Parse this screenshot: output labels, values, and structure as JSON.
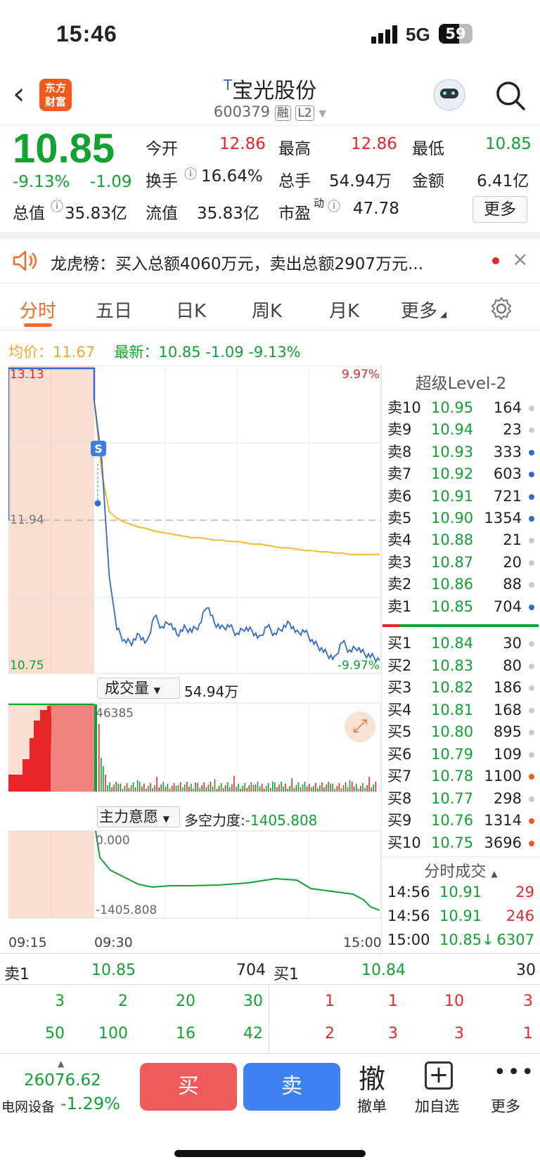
{
  "status": {
    "time": "15:46",
    "network": "5G",
    "battery": "59"
  },
  "header": {
    "logo_line1": "东方",
    "logo_line2": "财富",
    "title_prefix": "T",
    "title": "宝光股份",
    "code": "600379",
    "tag1": "融",
    "tag2": "L2"
  },
  "quote": {
    "price": "10.85",
    "pct": "-9.13%",
    "chg": "-1.09",
    "open_label": "今开",
    "open": "12.86",
    "high_label": "最高",
    "high": "12.86",
    "low_label": "最低",
    "low": "10.85",
    "turnover_label": "换手",
    "turnover": "16.64%",
    "volume_label": "总手",
    "volume": "54.94万",
    "amount_label": "金额",
    "amount": "6.41亿",
    "mcap_label": "总值",
    "mcap": "35.83亿",
    "float_label": "流值",
    "float": "35.83亿",
    "pe_label": "市盈",
    "pe_sup": "动",
    "pe": "47.78",
    "more": "更多"
  },
  "news": {
    "text": "龙虎榜：买入总额4060万元，卖出总额2907万元..."
  },
  "tabs": [
    "分时",
    "五日",
    "日K",
    "周K",
    "月K",
    "更多"
  ],
  "legend": {
    "avg_label": "均价：",
    "avg": "11.67",
    "last_label": "最新：",
    "last": "10.85",
    "chg": "-1.09",
    "pct": "-9.13%"
  },
  "chart_data": {
    "type": "line",
    "yaxis_top": "13.13",
    "yaxis_mid": "11.94",
    "yaxis_bottom": "10.75",
    "pct_top": "9.97%",
    "pct_bottom": "-9.97%",
    "ylim": [
      10.75,
      13.13
    ],
    "prev_close": 11.94,
    "price_series": [
      12.86,
      12.4,
      11.5,
      11.1,
      11.0,
      10.99,
      11.05,
      10.98,
      11.2,
      11.1,
      11.15,
      11.05,
      11.1,
      11.08,
      11.12,
      11.28,
      11.14,
      11.1,
      11.12,
      11.05,
      11.1,
      11.08,
      11.02,
      11.12,
      11.05,
      11.1,
      11.14,
      11.06,
      11.08,
      11.0,
      10.95,
      10.9,
      10.86,
      11.0,
      10.92,
      10.95,
      10.9,
      10.88,
      10.85
    ],
    "avg_series": [
      12.86,
      12.3,
      12.0,
      11.95,
      11.92,
      11.9,
      11.88,
      11.87,
      11.85,
      11.84,
      11.83,
      11.82,
      11.81,
      11.8,
      11.8,
      11.79,
      11.78,
      11.78,
      11.77,
      11.77,
      11.76,
      11.75,
      11.75,
      11.74,
      11.73,
      11.72,
      11.72,
      11.71,
      11.7,
      11.7,
      11.69,
      11.69,
      11.68,
      11.68,
      11.67,
      11.67,
      11.67,
      11.67,
      11.67
    ],
    "vol_label": "成交量",
    "vol_total": "54.94万",
    "vol_max": "46385",
    "flow_label": "主力意愿",
    "flow_title": "多空力度:",
    "flow_value": "-1405.808",
    "flow_top": "0.000",
    "flow_bottom": "-1405.808",
    "times": [
      "09:15",
      "09:30",
      "15:00"
    ]
  },
  "orderbook": {
    "title": "超级Level-2",
    "asks": [
      [
        "卖10",
        "10.95",
        "164",
        "#ccc"
      ],
      [
        "卖9",
        "10.94",
        "23",
        "#ccc"
      ],
      [
        "卖8",
        "10.93",
        "333",
        "#2f6ad0"
      ],
      [
        "卖7",
        "10.92",
        "603",
        "#2f6ad0"
      ],
      [
        "卖6",
        "10.91",
        "721",
        "#2f6ad0"
      ],
      [
        "卖5",
        "10.90",
        "1354",
        "#2f6ad0"
      ],
      [
        "卖4",
        "10.88",
        "21",
        "#ccc"
      ],
      [
        "卖3",
        "10.87",
        "20",
        "#ccc"
      ],
      [
        "卖2",
        "10.86",
        "88",
        "#ccc"
      ],
      [
        "卖1",
        "10.85",
        "704",
        "#2f6ad0"
      ]
    ],
    "bids": [
      [
        "买1",
        "10.84",
        "30",
        "#ccc"
      ],
      [
        "买2",
        "10.83",
        "80",
        "#ccc"
      ],
      [
        "买3",
        "10.82",
        "186",
        "#ccc"
      ],
      [
        "买4",
        "10.81",
        "168",
        "#ccc"
      ],
      [
        "买5",
        "10.80",
        "895",
        "#ccc"
      ],
      [
        "买6",
        "10.79",
        "109",
        "#ccc"
      ],
      [
        "买7",
        "10.78",
        "1100",
        "#ee5a1a"
      ],
      [
        "买8",
        "10.77",
        "298",
        "#ccc"
      ],
      [
        "买9",
        "10.76",
        "1314",
        "#ee5a1a"
      ],
      [
        "买10",
        "10.75",
        "3696",
        "#ee5a1a"
      ]
    ],
    "ticks_title": "分时成交",
    "ticks": [
      [
        "14:56",
        "10.91",
        "29"
      ],
      [
        "14:56",
        "10.91",
        "246"
      ],
      [
        "15:00",
        "10.85↓",
        "6307"
      ]
    ]
  },
  "queue": {
    "sell_label": "卖1",
    "sell_price": "10.85",
    "sell_vol": "704",
    "buy_label": "买1",
    "buy_price": "10.84",
    "buy_vol": "30",
    "sell_rows": [
      [
        "3",
        "2",
        "20",
        "30"
      ],
      [
        "50",
        "100",
        "16",
        "42"
      ]
    ],
    "buy_rows": [
      [
        "1",
        "1",
        "10",
        "3"
      ],
      [
        "2",
        "3",
        "3",
        "1"
      ]
    ]
  },
  "footer": {
    "index_value": "26076.62",
    "index_name": "电网设备",
    "index_pct": "-1.29%",
    "buy": "买",
    "sell": "卖",
    "cancel": "撤",
    "cancel_label": "撤单",
    "add_label": "加自选",
    "more_label": "更多"
  }
}
